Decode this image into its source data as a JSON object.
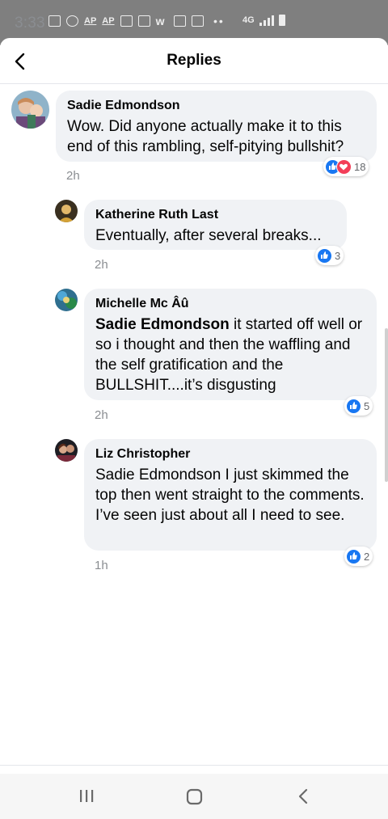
{
  "status_bar": {
    "time": "3:33",
    "ap1": "AP",
    "ap2": "AP",
    "dots": "••",
    "network": "4G"
  },
  "header": {
    "title": "Replies"
  },
  "comments": [
    {
      "author": "Sadie Edmondson",
      "text": "Wow. Did anyone actually make it to this end of this rambling, self-pitying bullshit?",
      "time": "2h",
      "reaction_count": "18",
      "reactions": [
        "like-icon",
        "love-icon"
      ]
    },
    {
      "author": "Katherine Ruth Last",
      "text": "Eventually, after several breaks...",
      "time": "2h",
      "reaction_count": "3",
      "reactions": [
        "like-icon"
      ]
    },
    {
      "author": "Michelle Mc Âû",
      "mention": "Sadie Edmondson",
      "text": " it started off well or so i thought and then the waffling and the self gratification and the BULLSHIT....it’s disgusting",
      "time": "2h",
      "reaction_count": "5",
      "reactions": [
        "like-icon"
      ]
    },
    {
      "author": "Liz Christopher",
      "text": "Sadie Edmondson I just skimmed the top then went straight to the comments. I’ve seen just about all I need to see.",
      "time": "1h",
      "reaction_count": "2",
      "reactions": [
        "like-icon"
      ]
    }
  ],
  "colors": {
    "bubble": "#f0f2f5",
    "like": "#1877f2",
    "love": "#f33e58",
    "timestamp": "#8a8d91"
  },
  "nav_bar": {
    "recents": "recents-icon",
    "home": "home-icon",
    "back": "back-icon"
  }
}
